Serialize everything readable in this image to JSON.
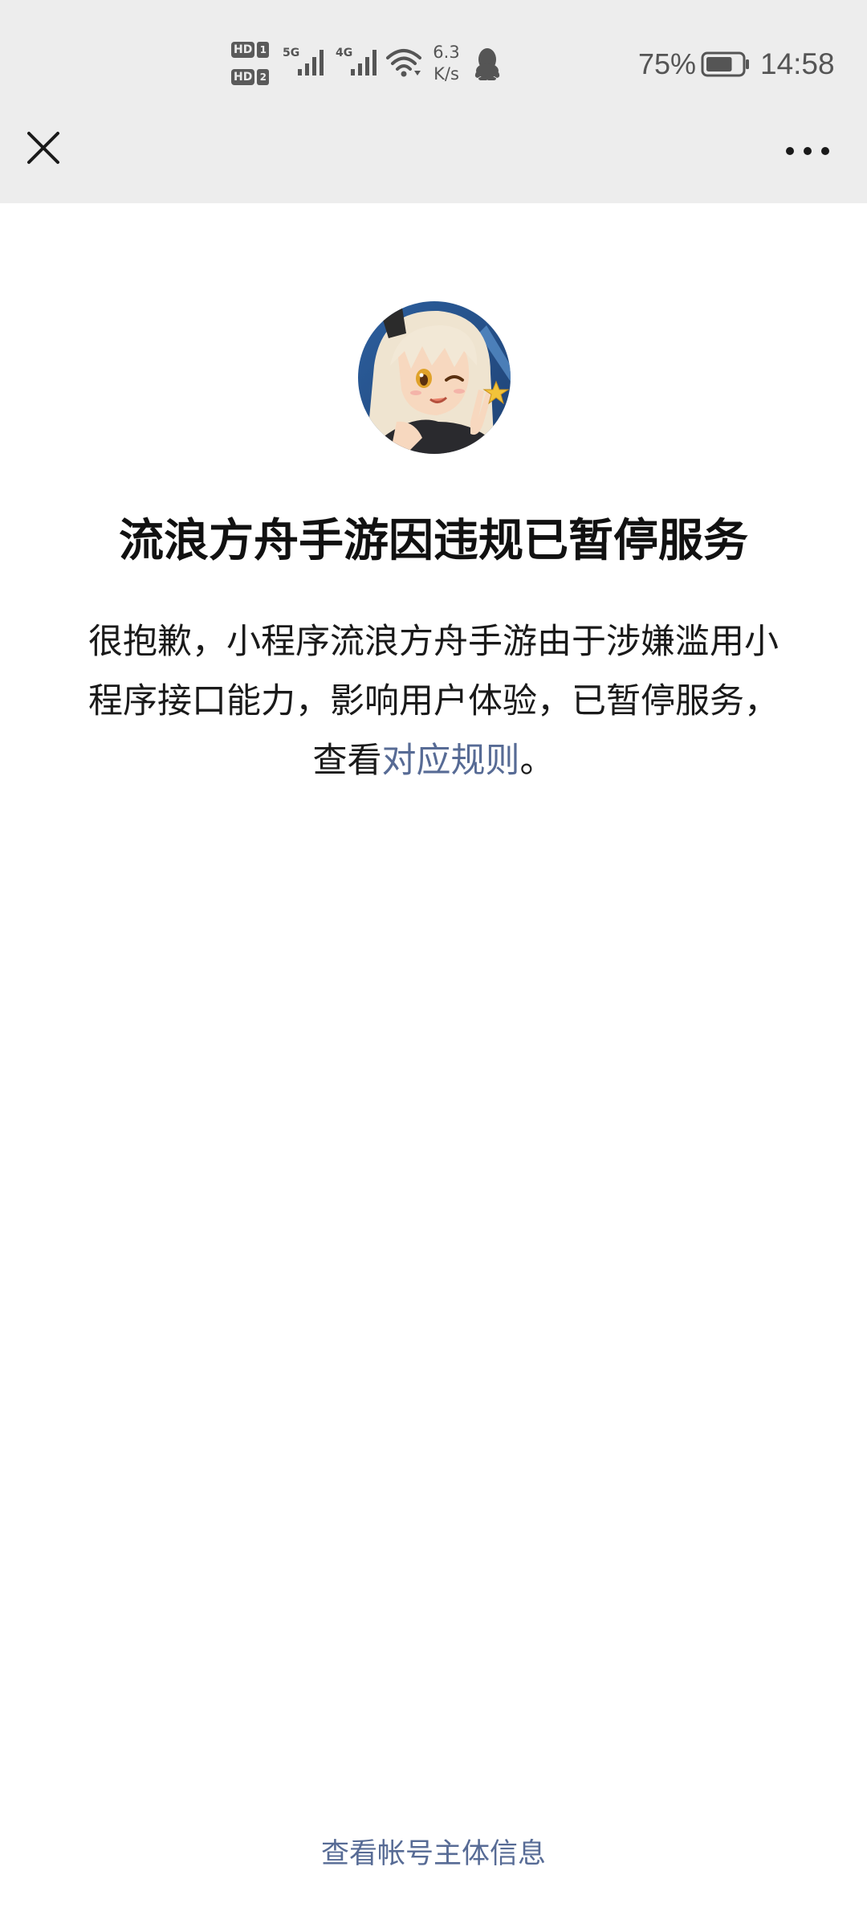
{
  "status_bar": {
    "sim1_label": "HD",
    "sim1_number": "1",
    "sim2_label": "HD",
    "sim2_number": "2",
    "network1": "5G",
    "network2": "4G",
    "speed_value": "6.3",
    "speed_unit": "K/s",
    "battery_percent": "75%",
    "battery_level": 0.75,
    "time": "14:58",
    "icons": [
      "signal-icon",
      "wifi-icon",
      "qq-icon",
      "battery-icon"
    ]
  },
  "nav_bar": {
    "close_icon": "close-icon",
    "more_icon": "more-icon"
  },
  "app": {
    "avatar": "anime-character-avatar"
  },
  "main": {
    "title": "流浪方舟手游因违规已暂停服务",
    "message_before_link": "很抱歉，小程序流浪方舟手游由于涉嫌滥用小程序接口能力，影响用户体验，已暂停服务，查看",
    "rules_link": "对应规则",
    "message_after_link": "。"
  },
  "footer": {
    "account_info_link": "查看帐号主体信息"
  },
  "colors": {
    "top_background": "#ededed",
    "link": "#576b95",
    "title": "#111111"
  }
}
